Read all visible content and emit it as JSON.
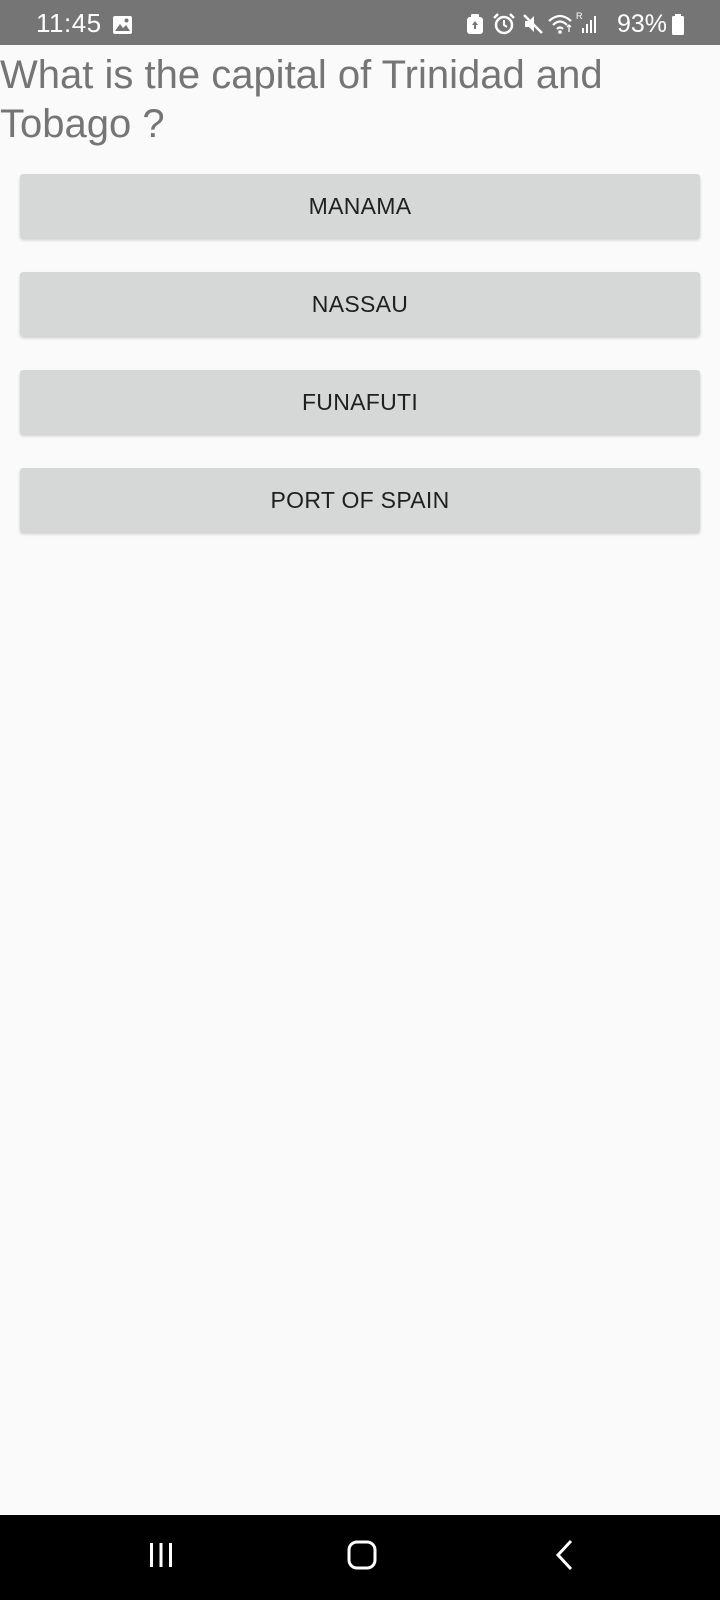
{
  "status_bar": {
    "time": "11:45",
    "battery": "93%",
    "icons": [
      "image-icon",
      "cleaner-icon",
      "alarm-icon",
      "mute-icon",
      "wifi-icon",
      "signal-icon",
      "battery-icon"
    ]
  },
  "quiz": {
    "question": "What is the capital of Trinidad and Tobago ?",
    "options": [
      {
        "label": "MANAMA"
      },
      {
        "label": "NASSAU"
      },
      {
        "label": "FUNAFUTI"
      },
      {
        "label": "PORT OF SPAIN"
      }
    ]
  },
  "nav_bar": {
    "buttons": [
      "recent-apps-icon",
      "home-icon",
      "back-icon"
    ]
  },
  "colors": {
    "status_bar_bg": "#757575",
    "page_bg": "#fafafa",
    "question_text": "#757575",
    "button_bg": "#d6d7d7",
    "button_text": "#1f1f1f",
    "nav_bar_bg": "#000000"
  }
}
